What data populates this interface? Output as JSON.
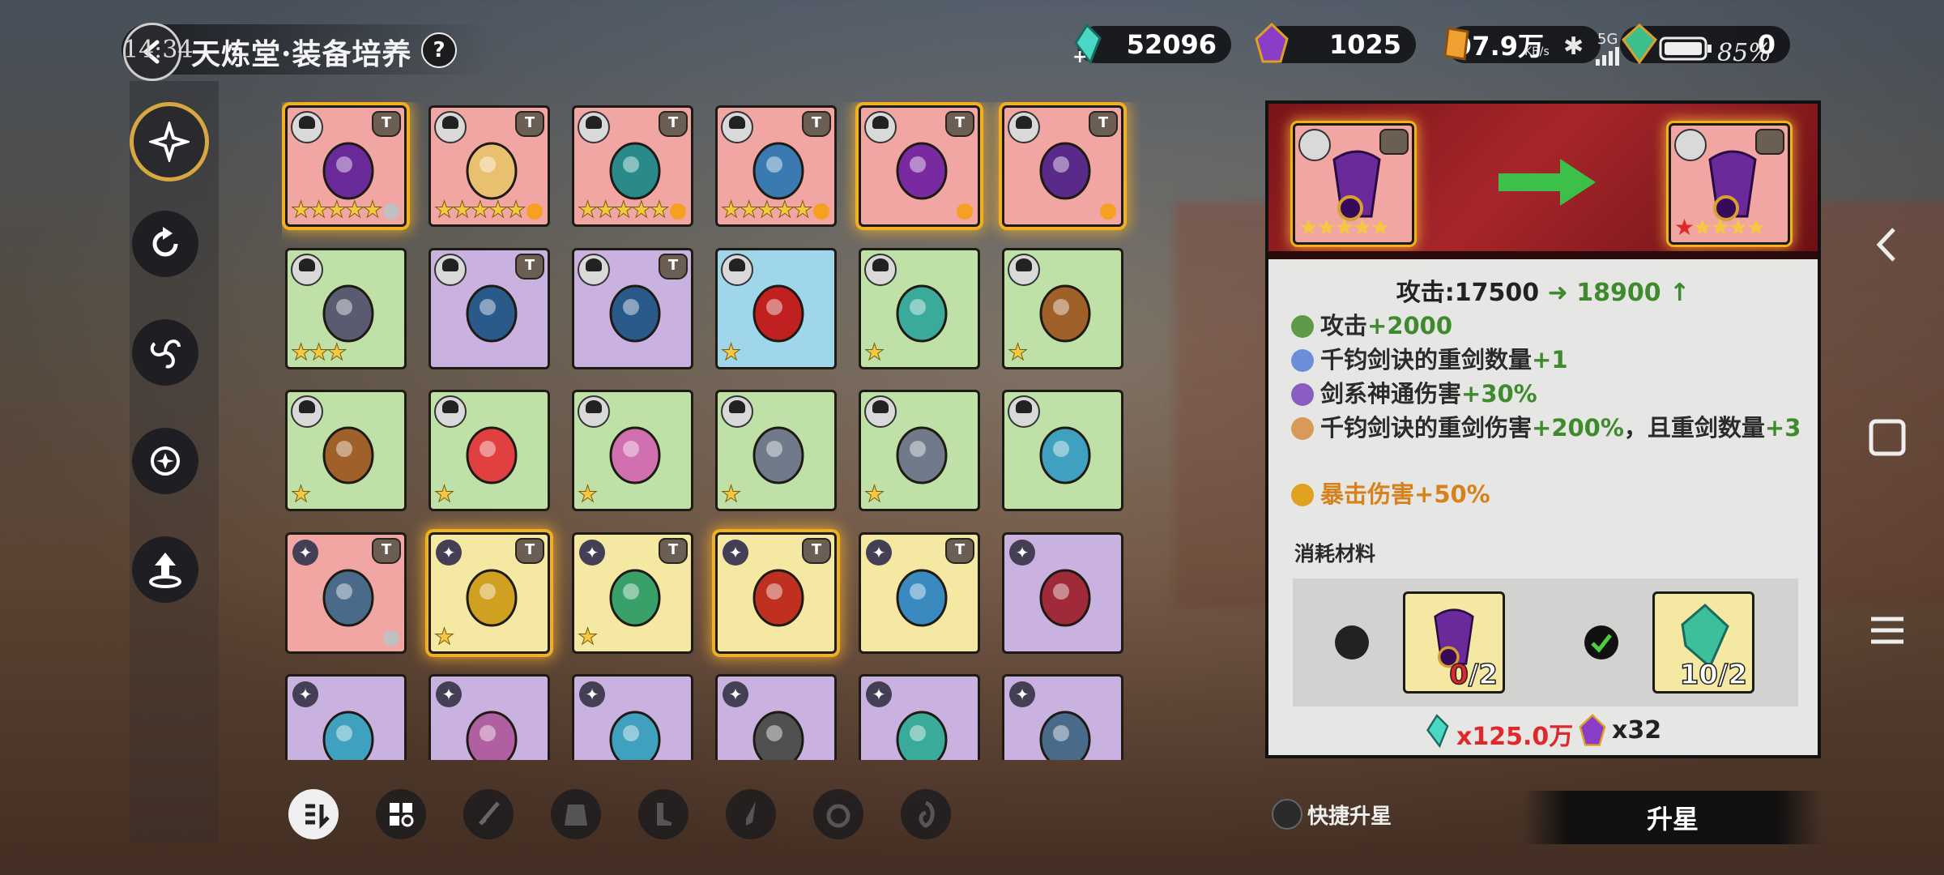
{
  "status": {
    "clock": "14:34",
    "net_speed": "97.9",
    "net_unit": "KB/s",
    "signal": "5G",
    "battery": "85%"
  },
  "header": {
    "title": "天炼堂·装备培养",
    "help": "?"
  },
  "resources": [
    {
      "name": "jade-crystal",
      "value": "52096"
    },
    {
      "name": "purple-stone",
      "value": "1025"
    },
    {
      "name": "gold-token",
      "value": "97.9万"
    },
    {
      "name": "green-gem",
      "value": "0"
    }
  ],
  "left_nav": [
    {
      "icon": "sparkle-icon",
      "active": true
    },
    {
      "icon": "refresh-icon",
      "active": false
    },
    {
      "icon": "swirl-icon",
      "active": false
    },
    {
      "icon": "cycle-icon",
      "active": false
    },
    {
      "icon": "upgrade-arrow-icon",
      "active": false
    }
  ],
  "inventory": [
    [
      {
        "bg": "red",
        "stars": "★★★★★",
        "glow": true,
        "item": "purple-fan",
        "flame": "grey"
      },
      {
        "bg": "red",
        "stars": "★★★★★",
        "glow": false,
        "item": "bead-necklace",
        "flame": "orange"
      },
      {
        "bg": "red",
        "stars": "★★★★★",
        "glow": false,
        "item": "jade-shoes",
        "flame": "orange"
      },
      {
        "bg": "red",
        "stars": "★★★★★",
        "glow": false,
        "item": "robe",
        "flame": "orange"
      },
      {
        "bg": "red",
        "stars": "",
        "glow": true,
        "item": "purple-bracelet",
        "flame": "orange"
      },
      {
        "bg": "red",
        "stars": "",
        "glow": true,
        "item": "purple-sword",
        "flame": "orange"
      }
    ],
    [
      {
        "bg": "green",
        "stars": "★★★",
        "glow": false,
        "item": "fur-armor"
      },
      {
        "bg": "purple",
        "stars": "",
        "glow": false,
        "item": "blue-boots"
      },
      {
        "bg": "purple",
        "stars": "",
        "glow": false,
        "item": "blue-boots"
      },
      {
        "bg": "blue",
        "stars": "★",
        "glow": false,
        "item": "red-vest"
      },
      {
        "bg": "green",
        "stars": "★",
        "glow": false,
        "item": "jade-blade"
      },
      {
        "bg": "green",
        "stars": "★",
        "glow": false,
        "item": "bronze-ring"
      }
    ],
    [
      {
        "bg": "green",
        "stars": "★",
        "glow": false,
        "item": "bronze-ring"
      },
      {
        "bg": "green",
        "stars": "★",
        "glow": false,
        "item": "red-fan"
      },
      {
        "bg": "green",
        "stars": "★",
        "glow": false,
        "item": "lotus-charm"
      },
      {
        "bg": "green",
        "stars": "★",
        "glow": false,
        "item": "shield-amulet"
      },
      {
        "bg": "green",
        "stars": "★",
        "glow": false,
        "item": "shield-amulet"
      },
      {
        "bg": "green",
        "stars": "",
        "glow": false,
        "item": "blue-ribbon"
      }
    ],
    [
      {
        "bg": "red",
        "stars": "",
        "glow": false,
        "item": "long-sword",
        "flame": "grey"
      },
      {
        "bg": "yellow",
        "stars": "★",
        "glow": true,
        "item": "gold-crown"
      },
      {
        "bg": "yellow",
        "stars": "★",
        "glow": false,
        "item": "jade-gourd"
      },
      {
        "bg": "yellow",
        "stars": "",
        "glow": true,
        "item": "red-sword"
      },
      {
        "bg": "yellow",
        "stars": "",
        "glow": false,
        "item": "dragon-charm"
      },
      {
        "bg": "purple",
        "stars": "",
        "glow": false,
        "item": "red-dagger"
      }
    ],
    [
      {
        "bg": "purple",
        "stars": "",
        "glow": false,
        "item": "blue-ribbon"
      },
      {
        "bg": "purple",
        "stars": "",
        "glow": false,
        "item": "bead-string"
      },
      {
        "bg": "purple",
        "stars": "",
        "glow": false,
        "item": "blue-ribbon"
      },
      {
        "bg": "purple",
        "stars": "",
        "glow": false,
        "item": "dark-staff"
      },
      {
        "bg": "purple",
        "stars": "",
        "glow": false,
        "item": "jade-blade"
      },
      {
        "bg": "purple",
        "stars": "",
        "glow": false,
        "item": "long-sword"
      }
    ]
  ],
  "categories": [
    {
      "icon": "filter-icon",
      "active": true
    },
    {
      "icon": "grid-icon",
      "active": false
    },
    {
      "icon": "sword-icon",
      "active": false
    },
    {
      "icon": "armor-icon",
      "active": false
    },
    {
      "icon": "boots-icon",
      "active": false
    },
    {
      "icon": "weapon-icon",
      "active": false
    },
    {
      "icon": "ring-icon",
      "active": false
    },
    {
      "icon": "charm-icon",
      "active": false
    }
  ],
  "detail": {
    "before_stars": "★★★★★",
    "after_stars": "★★★★★",
    "attack_label": "攻击:17500",
    "attack_new": "18900",
    "stats": [
      {
        "color": "#5e9a4a",
        "text": "攻击",
        "bonus": "+2000"
      },
      {
        "color": "#6a8fd8",
        "text": "千钧剑诀的重剑数量",
        "bonus": "+1"
      },
      {
        "color": "#8a5ec0",
        "text": "剑系神通伤害",
        "bonus": "+30%"
      },
      {
        "color": "#d89a5a",
        "text": "千钧剑诀的重剑伤害",
        "bonus": "+200%",
        "suffix": "，且重剑数量",
        "bonus2": "+3"
      },
      {
        "color": "#e0a020",
        "text": "暴击伤害",
        "bonus": "+50%",
        "orange": true
      }
    ],
    "materials_label": "消耗材料",
    "materials": [
      {
        "count": "0/2",
        "checked": false
      },
      {
        "count": "10/2",
        "checked": true
      }
    ],
    "cost": [
      {
        "icon": "jade-crystal",
        "value": "x125.0万",
        "color": "#e0282a"
      },
      {
        "icon": "purple-stone",
        "value": "x32",
        "color": "#222222"
      }
    ]
  },
  "actions": {
    "quick_upgrade": "快捷升星",
    "upgrade": "升星"
  }
}
